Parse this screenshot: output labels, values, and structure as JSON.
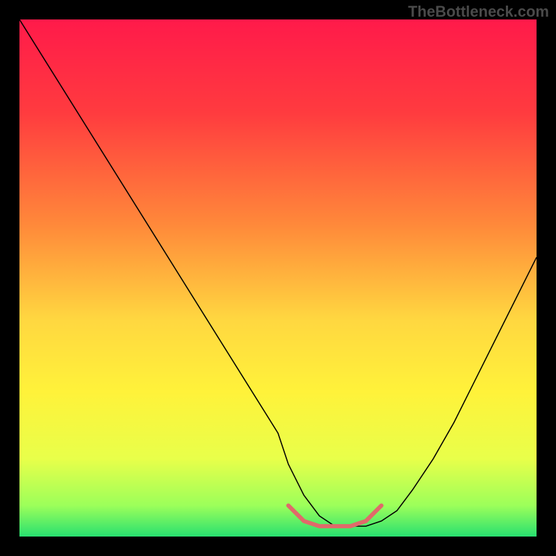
{
  "watermark": "TheBottleneck.com",
  "chart_data": {
    "type": "line",
    "title": "",
    "xlabel": "",
    "ylabel": "",
    "xlim": [
      0,
      100
    ],
    "ylim": [
      0,
      100
    ],
    "grid": false,
    "legend": false,
    "gradient_stops": [
      {
        "offset": 0,
        "color": "#ff1a4a"
      },
      {
        "offset": 18,
        "color": "#ff3b3f"
      },
      {
        "offset": 40,
        "color": "#ff8a3a"
      },
      {
        "offset": 58,
        "color": "#ffd740"
      },
      {
        "offset": 72,
        "color": "#fff23a"
      },
      {
        "offset": 85,
        "color": "#e8ff4a"
      },
      {
        "offset": 94,
        "color": "#9cff5a"
      },
      {
        "offset": 100,
        "color": "#28e070"
      }
    ],
    "series": [
      {
        "name": "curve",
        "stroke": "#000000",
        "stroke_width": 1.6,
        "x": [
          0,
          5,
          10,
          15,
          20,
          25,
          30,
          35,
          40,
          45,
          50,
          52,
          55,
          58,
          61,
          64,
          67,
          70,
          73,
          76,
          80,
          84,
          88,
          92,
          96,
          100
        ],
        "y": [
          100,
          92,
          84,
          76,
          68,
          60,
          52,
          44,
          36,
          28,
          20,
          14,
          8,
          4,
          2,
          2,
          2,
          3,
          5,
          9,
          15,
          22,
          30,
          38,
          46,
          54
        ]
      },
      {
        "name": "valley-highlight",
        "stroke": "#e06a6a",
        "stroke_width": 6,
        "x": [
          52,
          55,
          58,
          61,
          64,
          67,
          70
        ],
        "y": [
          6,
          3,
          2,
          2,
          2,
          3,
          6
        ]
      }
    ]
  }
}
